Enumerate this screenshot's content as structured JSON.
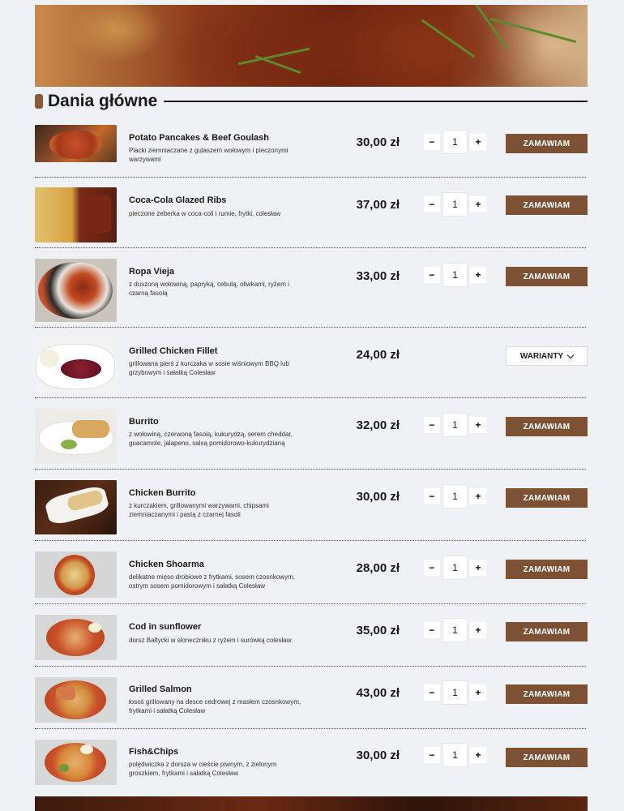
{
  "section": {
    "title": "Dania główne"
  },
  "currency_note": "zł",
  "items": [
    {
      "name": "Potato Pancakes & Beef Goulash",
      "desc": "Placki ziemniaczane z gulaszem wołowym i pieczonymi warzywami",
      "price": "30,00 zł",
      "qty": "1",
      "action": "ZAMAWIAM"
    },
    {
      "name": "Coca-Cola Glazed Ribs",
      "desc": "pieczone żeberka w coca-coli i rumie, frytki, colesław",
      "price": "37,00 zł",
      "qty": "1",
      "action": "ZAMAWIAM"
    },
    {
      "name": "Ropa Vieja",
      "desc": "z duszoną wołowiną, papryką, cebulą, oliwkami, ryżem i czarną fasolą",
      "price": "33,00 zł",
      "qty": "1",
      "action": "ZAMAWIAM"
    },
    {
      "name": "Grilled Chicken Fillet",
      "desc": "grillowana pierś z kurczaka w sosie wiśniowym BBQ lub grzybowym i sałatką Colesław",
      "price": "24,00 zł",
      "action": "WARIANTY"
    },
    {
      "name": "Burrito",
      "desc": "z wołowiną, czerwoną fasolą, kukurydzą, serem cheddar, guacamole, jalapeno, salsą pomidorowo-kukurydzianą",
      "price": "32,00 zł",
      "qty": "1",
      "action": "ZAMAWIAM"
    },
    {
      "name": "Chicken Burrito",
      "desc": "z kurczakiem, grillowanymi warzywami, chipsami ziemniaczanymi i pastą z czarnej fasoli",
      "price": "30,00 zł",
      "qty": "1",
      "action": "ZAMAWIAM"
    },
    {
      "name": "Chicken Shoarma",
      "desc": "delikatne mięso drobiowe z frytkami, sosem czosnkowym, ostrym sosem pomidorowym i sałatką Colesław",
      "price": "28,00 zł",
      "qty": "1",
      "action": "ZAMAWIAM"
    },
    {
      "name": "Cod in sunflower",
      "desc": "dorsz Bałtycki w słoneczniku z ryżem i surówką colesław.",
      "price": "35,00 zł",
      "qty": "1",
      "action": "ZAMAWIAM"
    },
    {
      "name": "Grilled Salmon",
      "desc": "łosoś grillowany na desce cedrowej z masłem czosnkowym, frytkami i sałatką Colesław",
      "price": "43,00 zł",
      "qty": "1",
      "action": "ZAMAWIAM"
    },
    {
      "name": "Fish&Chips",
      "desc": "polędwiczka z dorsza w cieście piwnym, z zielonym groszkiem, frytkami i sałatką Colesław",
      "price": "30,00 zł",
      "qty": "1",
      "action": "ZAMAWIAM"
    }
  ],
  "controls": {
    "minus": "−",
    "plus": "+"
  },
  "colors": {
    "accent": "#7d5234",
    "background": "#eef2f4"
  },
  "icons": {
    "variants": "chevron-down-icon"
  }
}
